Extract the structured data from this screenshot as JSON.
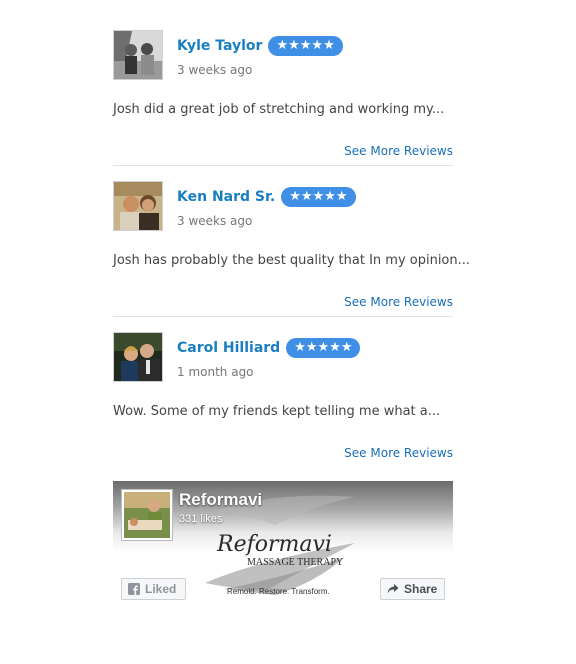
{
  "reviews": [
    {
      "name": "Kyle Taylor",
      "stars": "★★★★★",
      "when": "3 weeks ago",
      "excerpt": "Josh did a great job of stretching and working my...",
      "more": "See More Reviews"
    },
    {
      "name": "Ken Nard Sr.",
      "stars": "★★★★★",
      "when": "3 weeks ago",
      "excerpt": "Josh has probably the best quality that In my opinion...",
      "more": "See More Reviews"
    },
    {
      "name": "Carol Hilliard",
      "stars": "★★★★★",
      "when": "1 month ago",
      "excerpt": "Wow. Some of my friends kept telling me what a...",
      "more": "See More Reviews"
    }
  ],
  "facebook": {
    "page_name": "Reformavi",
    "likes": "331 likes",
    "logo_script": "Reformavi",
    "logo_subtitle": "MASSAGE THERAPY",
    "tagline": "Remold. Restore. Transform.",
    "liked_label": "Liked",
    "share_label": "Share",
    "liked_icon": "facebook-icon",
    "share_icon": "share-arrow-icon"
  },
  "colors": {
    "name_link": "#1a7fc1",
    "star_badge": "#3f8fe6",
    "more_link": "#1a6fb8"
  }
}
